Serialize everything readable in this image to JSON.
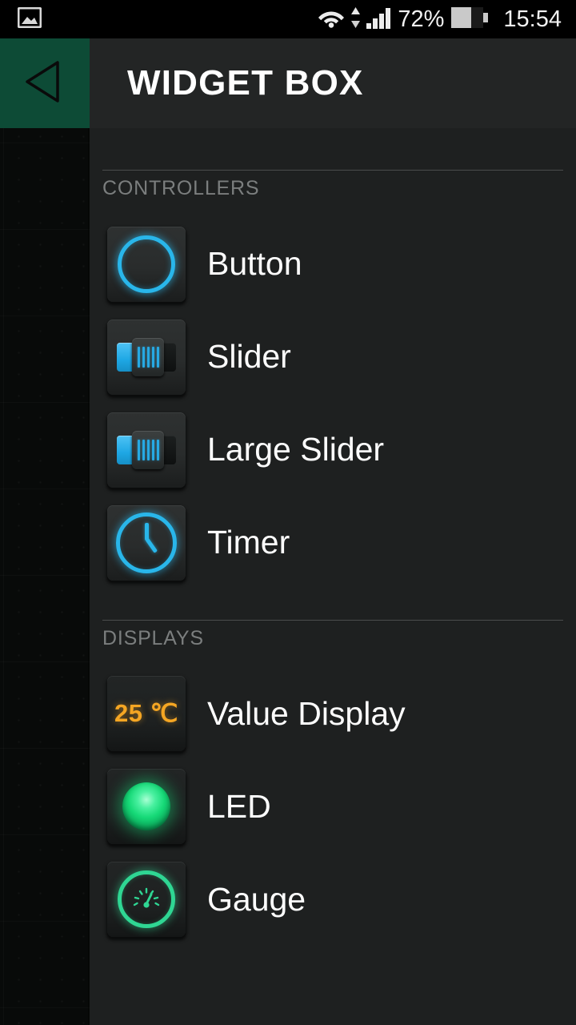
{
  "statusbar": {
    "left_icon": "image-gallery-icon",
    "wifi_icon": "wifi-icon",
    "data-arrows_icon": "data-transfer-arrows-icon",
    "signal_icon": "cellular-signal-icon",
    "battery_percent": "72%",
    "battery_icon": "battery-icon",
    "clock": "15:54"
  },
  "header": {
    "back_icon": "back-triangle-icon",
    "title": "WIDGET BOX"
  },
  "sections": [
    {
      "id": "controllers",
      "title": "CONTROLLERS",
      "items": [
        {
          "label": "Button",
          "icon": "button-ring-icon",
          "accent": "#29b6ea"
        },
        {
          "label": "Slider",
          "icon": "slider-icon",
          "accent": "#1ea7e4"
        },
        {
          "label": "Large Slider",
          "icon": "large-slider-icon",
          "accent": "#1ea7e4"
        },
        {
          "label": "Timer",
          "icon": "clock-icon",
          "accent": "#29b6ea"
        }
      ]
    },
    {
      "id": "displays",
      "title": "DISPLAYS",
      "items": [
        {
          "label": "Value Display",
          "icon": "value-display-icon",
          "accent": "#f5a623",
          "value_text": "25 ℃"
        },
        {
          "label": "LED",
          "icon": "led-icon",
          "accent": "#16d977"
        },
        {
          "label": "Gauge",
          "icon": "gauge-icon",
          "accent": "#2fd693"
        }
      ]
    }
  ],
  "colors": {
    "background": "#1e2020",
    "header_bg": "#232525",
    "back_button_bg": "#0d4b36",
    "statusbar_bg": "#000000",
    "section_title": "#7b7e7e",
    "divider": "#4a4c4c",
    "label_text": "#fdfdfd",
    "accent_blue": "#29b6ea",
    "accent_green": "#16d977",
    "accent_amber": "#f5a623"
  }
}
